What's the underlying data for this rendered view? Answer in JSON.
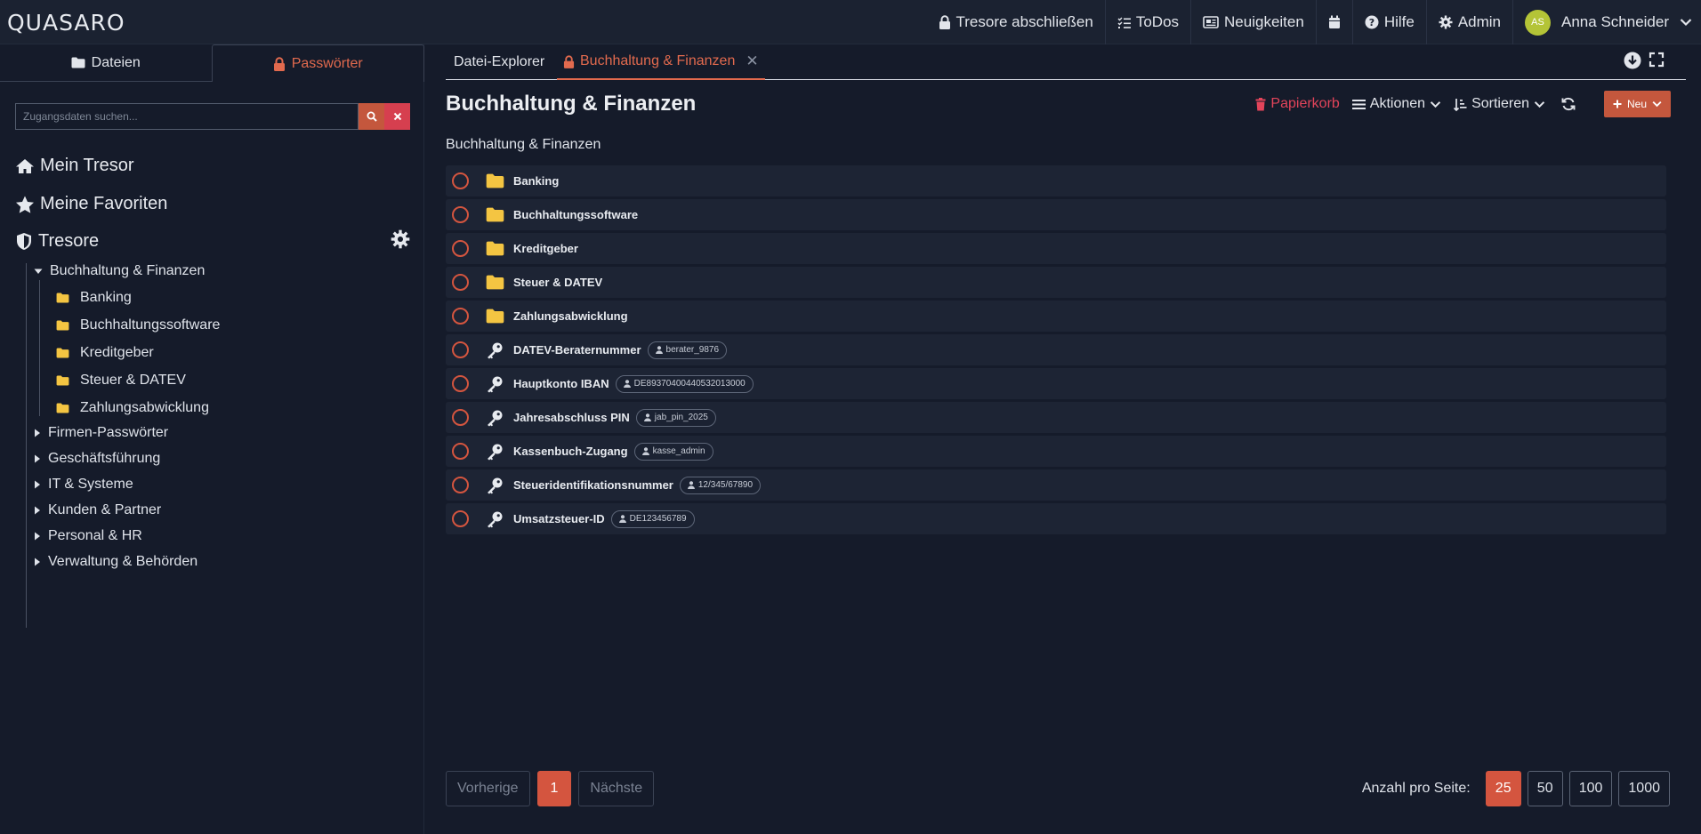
{
  "app": {
    "logo": "QUASARO"
  },
  "topnav": {
    "lock_vaults": "Tresore abschließen",
    "todos": "ToDos",
    "news": "Neuigkeiten",
    "help": "Hilfe",
    "admin": "Admin",
    "user_initials": "AS",
    "user_name": "Anna Schneider"
  },
  "left": {
    "tabs": [
      {
        "label": "Dateien",
        "icon": "folder-icon"
      },
      {
        "label": "Passwörter",
        "icon": "lock-icon",
        "active": true
      }
    ],
    "search": {
      "placeholder": "Zugangsdaten suchen..."
    },
    "nav": {
      "my_vault": "Mein Tresor",
      "favorites": "Meine Favoriten",
      "vaults": "Tresore"
    },
    "tree": {
      "root": "Buchhaltung & Finanzen",
      "children": [
        "Banking",
        "Buchhaltungssoftware",
        "Kreditgeber",
        "Steuer & DATEV",
        "Zahlungsabwicklung"
      ],
      "siblings": [
        "Firmen-Passwörter",
        "Geschäftsführung",
        "IT & Systeme",
        "Kunden & Partner",
        "Personal & HR",
        "Verwaltung & Behörden"
      ]
    }
  },
  "main": {
    "tabs": {
      "explorer": "Datei-Explorer",
      "active": "Buchhaltung & Finanzen"
    },
    "title": "Buchhaltung & Finanzen",
    "breadcrumb": "Buchhaltung & Finanzen",
    "actions": {
      "trash": "Papierkorb",
      "actions": "Aktionen",
      "sort": "Sortieren",
      "new": "Neu"
    },
    "folders": [
      "Banking",
      "Buchhaltungssoftware",
      "Kreditgeber",
      "Steuer & DATEV",
      "Zahlungsabwicklung"
    ],
    "entries": [
      {
        "name": "DATEV-Beraternummer",
        "user": "berater_9876"
      },
      {
        "name": "Hauptkonto IBAN",
        "user": "DE89370400440532013000"
      },
      {
        "name": "Jahresabschluss PIN",
        "user": "jab_pin_2025"
      },
      {
        "name": "Kassenbuch-Zugang",
        "user": "kasse_admin"
      },
      {
        "name": "Steueridentifikationsnummer",
        "user": "12/345/67890"
      },
      {
        "name": "Umsatzsteuer-ID",
        "user": "DE123456789"
      }
    ],
    "pager": {
      "prev": "Vorherige",
      "page": "1",
      "next": "Nächste"
    },
    "per_page": {
      "label": "Anzahl pro Seite:",
      "options": [
        "25",
        "50",
        "100",
        "1000"
      ],
      "selected": "25"
    }
  },
  "colors": {
    "accent": "#d4553f",
    "danger": "#e2445a",
    "folder": "#f4c542",
    "background": "#151b2a"
  }
}
